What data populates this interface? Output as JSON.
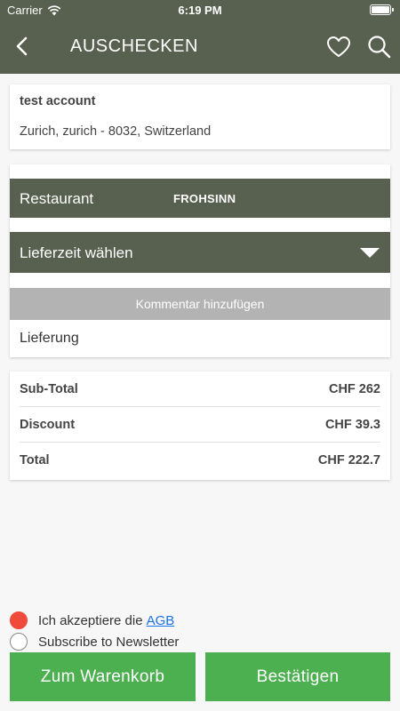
{
  "status_bar": {
    "carrier": "Carrier",
    "time": "6:19 PM"
  },
  "nav": {
    "title": "AUSCHECKEN"
  },
  "address": {
    "name": "test account",
    "line": "Zurich, zurich - 8032, Switzerland"
  },
  "order": {
    "restaurant_label": "Restaurant",
    "restaurant_name": "FROHSINN",
    "delivery_time_label": "Lieferzeit wählen",
    "comment_button": "Kommentar hinzufügen",
    "delivery_type": "Lieferung"
  },
  "totals": [
    {
      "label": "Sub-Total",
      "value": "CHF 262"
    },
    {
      "label": "Discount",
      "value": "CHF 39.3"
    },
    {
      "label": "Total",
      "value": "CHF 222.7"
    }
  ],
  "consent": {
    "terms_text": "Ich akzeptiere die",
    "terms_link": "AGB",
    "terms_checked": true,
    "newsletter_text": "Subscribe to Newsletter",
    "newsletter_checked": false
  },
  "buttons": {
    "cart": "Zum Warenkorb",
    "confirm": "Bestätigen"
  },
  "colors": {
    "header": "#58614f",
    "primary_button": "#4caf50",
    "comment_bar": "#b3b3b3",
    "radio_checked": "#f04a3a",
    "link": "#1a73e8"
  }
}
